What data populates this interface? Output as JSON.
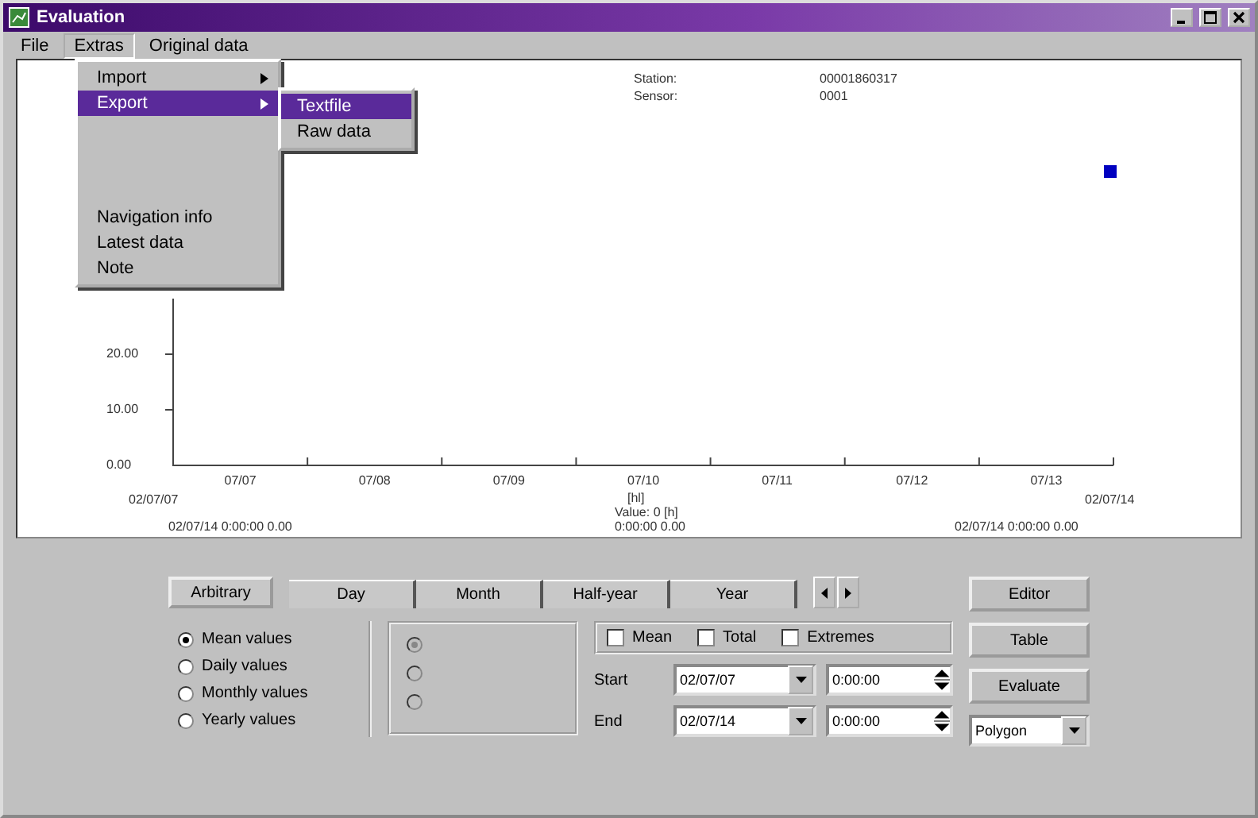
{
  "window": {
    "title": "Evaluation"
  },
  "menu_bar": [
    {
      "label": "File",
      "open": false
    },
    {
      "label": "Extras",
      "open": true
    },
    {
      "label": "Original data",
      "open": false
    }
  ],
  "extras_menu": [
    {
      "label": "Import",
      "submenu": true,
      "selected": false
    },
    {
      "label": "Export",
      "submenu": true,
      "selected": true
    },
    {
      "label": "Navigation info",
      "submenu": false,
      "selected": false
    },
    {
      "label": "Latest data",
      "submenu": false,
      "selected": false
    },
    {
      "label": "Note",
      "submenu": false,
      "selected": false
    }
  ],
  "export_submenu": [
    {
      "label": "Textfile",
      "selected": true
    },
    {
      "label": "Raw data",
      "selected": false
    }
  ],
  "info": [
    {
      "label": "Station:",
      "value": "00001860317"
    },
    {
      "label": "Sensor:",
      "value": "0001"
    }
  ],
  "chart": {
    "yticks": [
      "20.00",
      "10.00",
      "0.00"
    ],
    "xticks": [
      "07/07",
      "07/08",
      "07/09",
      "07/10",
      "07/11",
      "07/12",
      "07/13"
    ],
    "start_date": "02/07/07",
    "end_date": "02/07/14",
    "cursor": [
      "[hl]",
      "Value: 0 [h]",
      "0:00:00  0.00"
    ],
    "left_reading": "02/07/14 0:00:00  0.00",
    "right_reading": "02/07/14 0:00:00  0.00"
  },
  "tabs": [
    {
      "label": "Arbitrary",
      "selected": true
    },
    {
      "label": "Day",
      "selected": false
    },
    {
      "label": "Month",
      "selected": false
    },
    {
      "label": "Half-year",
      "selected": false
    },
    {
      "label": "Year",
      "selected": false
    }
  ],
  "value_types": [
    {
      "label": "Mean values",
      "selected": true
    },
    {
      "label": "Daily values",
      "selected": false
    },
    {
      "label": "Monthly values",
      "selected": false
    },
    {
      "label": "Yearly values",
      "selected": false
    }
  ],
  "disabled_options": [
    {
      "selected": true
    },
    {
      "selected": false
    },
    {
      "selected": false
    }
  ],
  "checks": [
    {
      "label": "Mean",
      "checked": false
    },
    {
      "label": "Total",
      "checked": false
    },
    {
      "label": "Extremes",
      "checked": false
    }
  ],
  "start": {
    "label": "Start",
    "date": "02/07/07",
    "time": "0:00:00"
  },
  "end": {
    "label": "End",
    "date": "02/07/14",
    "time": "0:00:00"
  },
  "buttons": [
    "Editor",
    "Table",
    "Evaluate"
  ],
  "display_mode": "Polygon"
}
